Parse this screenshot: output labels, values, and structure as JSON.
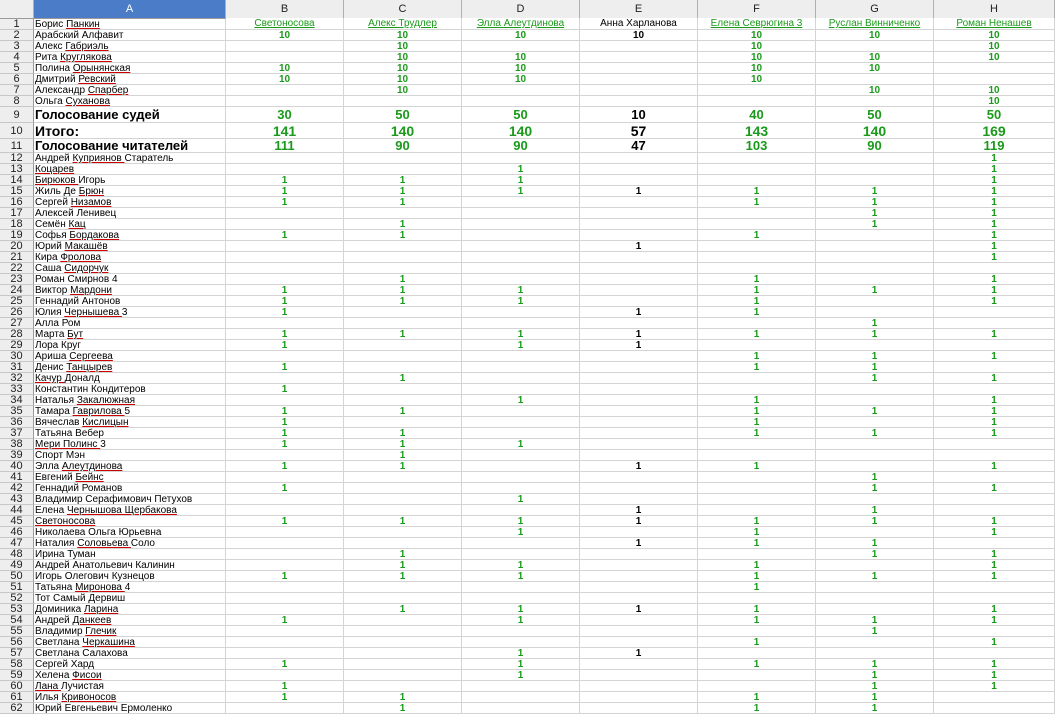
{
  "columns": [
    "A",
    "B",
    "C",
    "D",
    "E",
    "F",
    "G",
    "H"
  ],
  "headers": [
    "",
    "Светоносова",
    "Алекс Трудлер",
    "Элла Алеутдинова",
    "Анна Харланова",
    "Елена Севрюгина 3",
    "Руслан Винниченко",
    "Роман Ненашев"
  ],
  "rows": [
    {
      "n": "1",
      "a": "Борис Панкин",
      "v": [
        "",
        "",
        "10",
        "",
        "",
        "10",
        ""
      ]
    },
    {
      "n": "2",
      "a": "Арабский Алфавит",
      "v": [
        "10",
        "10",
        "10",
        "10",
        "10",
        "10",
        "10"
      ]
    },
    {
      "n": "3",
      "a": "Алекс Габриэль",
      "v": [
        "",
        "10",
        "",
        "",
        "10",
        "",
        "10"
      ]
    },
    {
      "n": "4",
      "a": "Рита Круглякова",
      "v": [
        "",
        "10",
        "10",
        "",
        "10",
        "10",
        "10"
      ]
    },
    {
      "n": "5",
      "a": "Полина Орынянская",
      "v": [
        "10",
        "10",
        "10",
        "",
        "10",
        "10",
        ""
      ]
    },
    {
      "n": "6",
      "a": "Дмитрий Ревский",
      "v": [
        "10",
        "10",
        "10",
        "",
        "10",
        "",
        ""
      ]
    },
    {
      "n": "7",
      "a": "Александр Спарбер",
      "v": [
        "",
        "10",
        "",
        "",
        "",
        "10",
        "10"
      ]
    },
    {
      "n": "8",
      "a": "Ольга Суханова",
      "v": [
        "",
        "",
        "",
        "",
        "",
        "",
        "10"
      ]
    },
    {
      "n": "9",
      "a": "Голосование судей",
      "v": [
        "30",
        "50",
        "50",
        "10",
        "40",
        "50",
        "50"
      ]
    },
    {
      "n": "10",
      "a": "Итого:",
      "v": [
        "141",
        "140",
        "140",
        "57",
        "143",
        "140",
        "169"
      ]
    },
    {
      "n": "11",
      "a": "Голосование читателей",
      "v": [
        "111",
        "90",
        "90",
        "47",
        "103",
        "90",
        "119"
      ]
    },
    {
      "n": "12",
      "a": "Андрей Куприянов Старатель",
      "v": [
        "",
        "",
        "",
        "",
        "",
        "",
        "1"
      ]
    },
    {
      "n": "13",
      "a": "Коцарев",
      "v": [
        "",
        "",
        "1",
        "",
        "",
        "",
        "1"
      ]
    },
    {
      "n": "14",
      "a": "Бирюков Игорь",
      "v": [
        "1",
        "1",
        "1",
        "",
        "",
        "",
        "1"
      ]
    },
    {
      "n": "15",
      "a": "Жиль Де Брюн",
      "v": [
        "1",
        "1",
        "1",
        "1",
        "1",
        "1",
        "1"
      ]
    },
    {
      "n": "16",
      "a": "Сергей Низамов",
      "v": [
        "1",
        "1",
        "",
        "",
        "1",
        "1",
        "1"
      ]
    },
    {
      "n": "17",
      "a": "Алексей Ленивец",
      "v": [
        "",
        "",
        "",
        "",
        "",
        "1",
        "1"
      ]
    },
    {
      "n": "18",
      "a": "Семён Кац",
      "v": [
        "",
        "1",
        "",
        "",
        "",
        "1",
        "1"
      ]
    },
    {
      "n": "19",
      "a": "Софья Бордакова",
      "v": [
        "1",
        "1",
        "",
        "",
        "1",
        "",
        "1"
      ]
    },
    {
      "n": "20",
      "a": "Юрий Макашёв",
      "v": [
        "",
        "",
        "",
        "1",
        "",
        "",
        "1"
      ]
    },
    {
      "n": "21",
      "a": "Кира Фролова",
      "v": [
        "",
        "",
        "",
        "",
        "",
        "",
        "1"
      ]
    },
    {
      "n": "22",
      "a": "Саша Сидорчук",
      "v": [
        "",
        "",
        "",
        "",
        "",
        "",
        ""
      ]
    },
    {
      "n": "23",
      "a": "Роман Смирнов 4",
      "v": [
        "",
        "1",
        "",
        "",
        "1",
        "",
        "1"
      ]
    },
    {
      "n": "24",
      "a": "Виктор Мардони",
      "v": [
        "1",
        "1",
        "1",
        "",
        "1",
        "1",
        "1"
      ]
    },
    {
      "n": "25",
      "a": "Геннадий Антонов",
      "v": [
        "1",
        "1",
        "1",
        "",
        "1",
        "",
        "1"
      ]
    },
    {
      "n": "26",
      "a": "Юлия Чернышева 3",
      "v": [
        "1",
        "",
        "",
        "1",
        "1",
        "",
        ""
      ]
    },
    {
      "n": "27",
      "a": "Алла Ром",
      "v": [
        "",
        "",
        "",
        "",
        "",
        "1",
        ""
      ]
    },
    {
      "n": "28",
      "a": "Марта Бут",
      "v": [
        "1",
        "1",
        "1",
        "1",
        "1",
        "1",
        "1"
      ]
    },
    {
      "n": "29",
      "a": "Лора Круг",
      "v": [
        "1",
        "",
        "1",
        "1",
        "",
        "",
        ""
      ]
    },
    {
      "n": "30",
      "a": "Ариша Сергеева",
      "v": [
        "",
        "",
        "",
        "",
        "1",
        "1",
        "1"
      ]
    },
    {
      "n": "31",
      "a": "Денис Танцырев",
      "v": [
        "1",
        "",
        "",
        "",
        "1",
        "1",
        ""
      ]
    },
    {
      "n": "32",
      "a": "Качур Доналд",
      "v": [
        "",
        "1",
        "",
        "",
        "",
        "1",
        "1"
      ]
    },
    {
      "n": "33",
      "a": "Константин Кондитеров",
      "v": [
        "1",
        "",
        "",
        "",
        "",
        "",
        ""
      ]
    },
    {
      "n": "34",
      "a": "Наталья Закалюжная",
      "v": [
        "",
        "",
        "1",
        "",
        "1",
        "",
        "1"
      ]
    },
    {
      "n": "35",
      "a": "Тамара Гаврилова 5",
      "v": [
        "1",
        "1",
        "",
        "",
        "1",
        "1",
        "1"
      ]
    },
    {
      "n": "36",
      "a": "Вячеслав Кислицын",
      "v": [
        "1",
        "",
        "",
        "",
        "1",
        "",
        "1"
      ]
    },
    {
      "n": "37",
      "a": "Татьяна Вебер",
      "v": [
        "1",
        "1",
        "",
        "",
        "1",
        "1",
        "1"
      ]
    },
    {
      "n": "38",
      "a": "Мери Полинс 3",
      "v": [
        "1",
        "1",
        "1",
        "",
        "",
        "",
        ""
      ]
    },
    {
      "n": "39",
      "a": "Спорт Мэн",
      "v": [
        "",
        "1",
        "",
        "",
        "",
        "",
        ""
      ]
    },
    {
      "n": "40",
      "a": "Элла Алеутдинова",
      "v": [
        "1",
        "1",
        "",
        "1",
        "1",
        "",
        "1"
      ]
    },
    {
      "n": "41",
      "a": "Евгений Бейнс",
      "v": [
        "",
        "",
        "",
        "",
        "",
        "1",
        ""
      ]
    },
    {
      "n": "42",
      "a": "Геннадий Романов",
      "v": [
        "1",
        "",
        "",
        "",
        "",
        "1",
        "1"
      ]
    },
    {
      "n": "43",
      "a": "Владимир Серафимович Петухов",
      "v": [
        "",
        "",
        "1",
        "",
        "",
        "",
        ""
      ]
    },
    {
      "n": "44",
      "a": "Елена Чернышова Щербакова",
      "v": [
        "",
        "",
        "",
        "1",
        "",
        "1",
        ""
      ]
    },
    {
      "n": "45",
      "a": "Светоносова",
      "v": [
        "1",
        "1",
        "1",
        "1",
        "1",
        "1",
        "1"
      ]
    },
    {
      "n": "46",
      "a": "Николаева Ольга Юрьевна",
      "v": [
        "",
        "",
        "1",
        "",
        "1",
        "",
        "1"
      ]
    },
    {
      "n": "47",
      "a": "Наталия Соловьева Соло",
      "v": [
        "",
        "",
        "",
        "1",
        "1",
        "1",
        ""
      ]
    },
    {
      "n": "48",
      "a": "Ирина Туман",
      "v": [
        "",
        "1",
        "",
        "",
        "",
        "1",
        "1"
      ]
    },
    {
      "n": "49",
      "a": "Андрей Анатольевич Калинин",
      "v": [
        "",
        "1",
        "1",
        "",
        "1",
        "",
        "1"
      ]
    },
    {
      "n": "50",
      "a": "Игорь Олегович Кузнецов",
      "v": [
        "1",
        "1",
        "1",
        "",
        "1",
        "1",
        "1"
      ]
    },
    {
      "n": "51",
      "a": "Татьяна Миронова 4",
      "v": [
        "",
        "",
        "",
        "",
        "1",
        "",
        ""
      ]
    },
    {
      "n": "52",
      "a": "Тот Самый Дервиш",
      "v": [
        "",
        "",
        "",
        "",
        "",
        "",
        ""
      ]
    },
    {
      "n": "53",
      "a": "Доминика Ларина",
      "v": [
        "",
        "1",
        "1",
        "1",
        "1",
        "",
        "1"
      ]
    },
    {
      "n": "54",
      "a": "Андрей Данкеев",
      "v": [
        "1",
        "",
        "1",
        "",
        "1",
        "1",
        "1"
      ]
    },
    {
      "n": "55",
      "a": "Владимир Глечик",
      "v": [
        "",
        "",
        "",
        "",
        "",
        "1",
        ""
      ]
    },
    {
      "n": "56",
      "a": "Светлана Черкашина",
      "v": [
        "",
        "",
        "",
        "",
        "1",
        "",
        "1"
      ]
    },
    {
      "n": "57",
      "a": "Светлана Салахова",
      "v": [
        "",
        "",
        "1",
        "1",
        "",
        "",
        ""
      ]
    },
    {
      "n": "58",
      "a": "Сергей Хард",
      "v": [
        "1",
        "",
        "1",
        "",
        "1",
        "1",
        "1"
      ]
    },
    {
      "n": "59",
      "a": "Хелена Фисои",
      "v": [
        "",
        "",
        "1",
        "",
        "",
        "1",
        "1"
      ]
    },
    {
      "n": "60",
      "a": "Лана Лучистая",
      "v": [
        "1",
        "",
        "",
        "",
        "",
        "1",
        "1"
      ]
    },
    {
      "n": "61",
      "a": "Илья Кривоносов",
      "v": [
        "1",
        "1",
        "",
        "",
        "1",
        "1",
        ""
      ]
    },
    {
      "n": "62",
      "a": "Юрий Евгеньевич Ермоленко",
      "v": [
        "",
        "1",
        "",
        "",
        "1",
        "1",
        ""
      ]
    }
  ]
}
